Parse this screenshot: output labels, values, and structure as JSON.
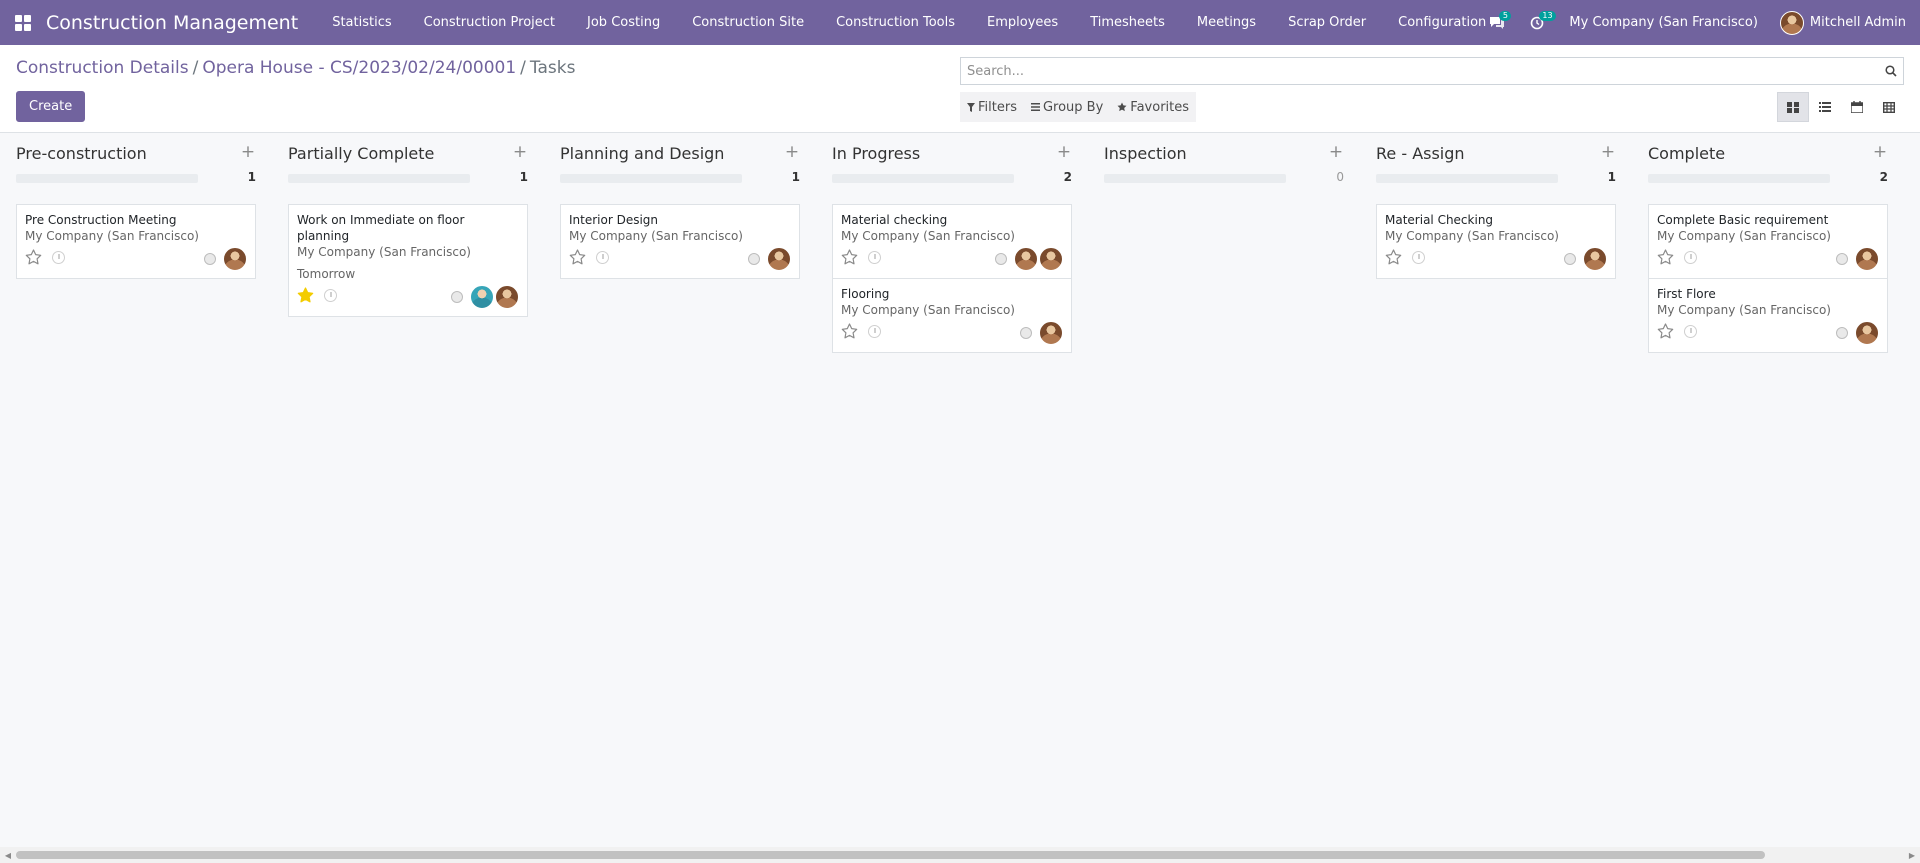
{
  "app": {
    "title": "Construction Management"
  },
  "menu": [
    {
      "label": "Statistics"
    },
    {
      "label": "Construction Project"
    },
    {
      "label": "Job Costing"
    },
    {
      "label": "Construction Site"
    },
    {
      "label": "Construction Tools"
    },
    {
      "label": "Employees"
    },
    {
      "label": "Timesheets"
    },
    {
      "label": "Meetings"
    },
    {
      "label": "Scrap Order"
    },
    {
      "label": "Configuration"
    }
  ],
  "systray": {
    "messages_count": "5",
    "activities_count": "13",
    "company": "My Company (San Francisco)",
    "user_name": "Mitchell Admin"
  },
  "breadcrumb": [
    {
      "label": "Construction Details"
    },
    {
      "label": "Opera House - CS/2023/02/24/00001"
    },
    {
      "label": "Tasks"
    }
  ],
  "toolbar": {
    "create_label": "Create",
    "search_placeholder": "Search...",
    "filters_label": "Filters",
    "groupby_label": "Group By",
    "favorites_label": "Favorites"
  },
  "columns": [
    {
      "title": "Pre-construction",
      "count": "1",
      "cards": [
        {
          "title": "Pre Construction Meeting",
          "company": "My Company (San Francisco)",
          "date": "",
          "starred": false,
          "avatars": [
            "user"
          ]
        }
      ]
    },
    {
      "title": "Partially Complete",
      "count": "1",
      "cards": [
        {
          "title": "Work on Immediate on floor planning",
          "company": "My Company (San Francisco)",
          "date": "Tomorrow",
          "starred": true,
          "avatars": [
            "alt",
            "user"
          ]
        }
      ]
    },
    {
      "title": "Planning and Design",
      "count": "1",
      "cards": [
        {
          "title": "Interior Design",
          "company": "My Company (San Francisco)",
          "date": "",
          "starred": false,
          "avatars": [
            "user"
          ]
        }
      ]
    },
    {
      "title": "In Progress",
      "count": "2",
      "cards": [
        {
          "title": "Material checking",
          "company": "My Company (San Francisco)",
          "date": "",
          "starred": false,
          "avatars": [
            "user",
            "user"
          ]
        },
        {
          "title": "Flooring",
          "company": "My Company (San Francisco)",
          "date": "",
          "starred": false,
          "avatars": [
            "user"
          ]
        }
      ]
    },
    {
      "title": "Inspection",
      "count": "0",
      "cards": []
    },
    {
      "title": "Re - Assign",
      "count": "1",
      "cards": [
        {
          "title": "Material Checking",
          "company": "My Company (San Francisco)",
          "date": "",
          "starred": false,
          "avatars": [
            "user"
          ]
        }
      ]
    },
    {
      "title": "Complete",
      "count": "2",
      "cards": [
        {
          "title": "Complete Basic requirement",
          "company": "My Company (San Francisco)",
          "date": "",
          "starred": false,
          "avatars": [
            "user"
          ]
        },
        {
          "title": "First Flore",
          "company": "My Company (San Francisco)",
          "date": "",
          "starred": false,
          "avatars": [
            "user"
          ]
        }
      ]
    }
  ],
  "colors": {
    "brand": "#71639e",
    "star_on": "#f3cc00",
    "star_off": "#8a8a8a"
  },
  "icons": {
    "apps": "apps-grid-icon",
    "messages": "chat-bubbles-icon",
    "activities": "clock-activity-icon",
    "search": "magnifier-icon",
    "views": [
      "kanban-icon",
      "list-icon",
      "calendar-icon",
      "table-icon"
    ]
  }
}
